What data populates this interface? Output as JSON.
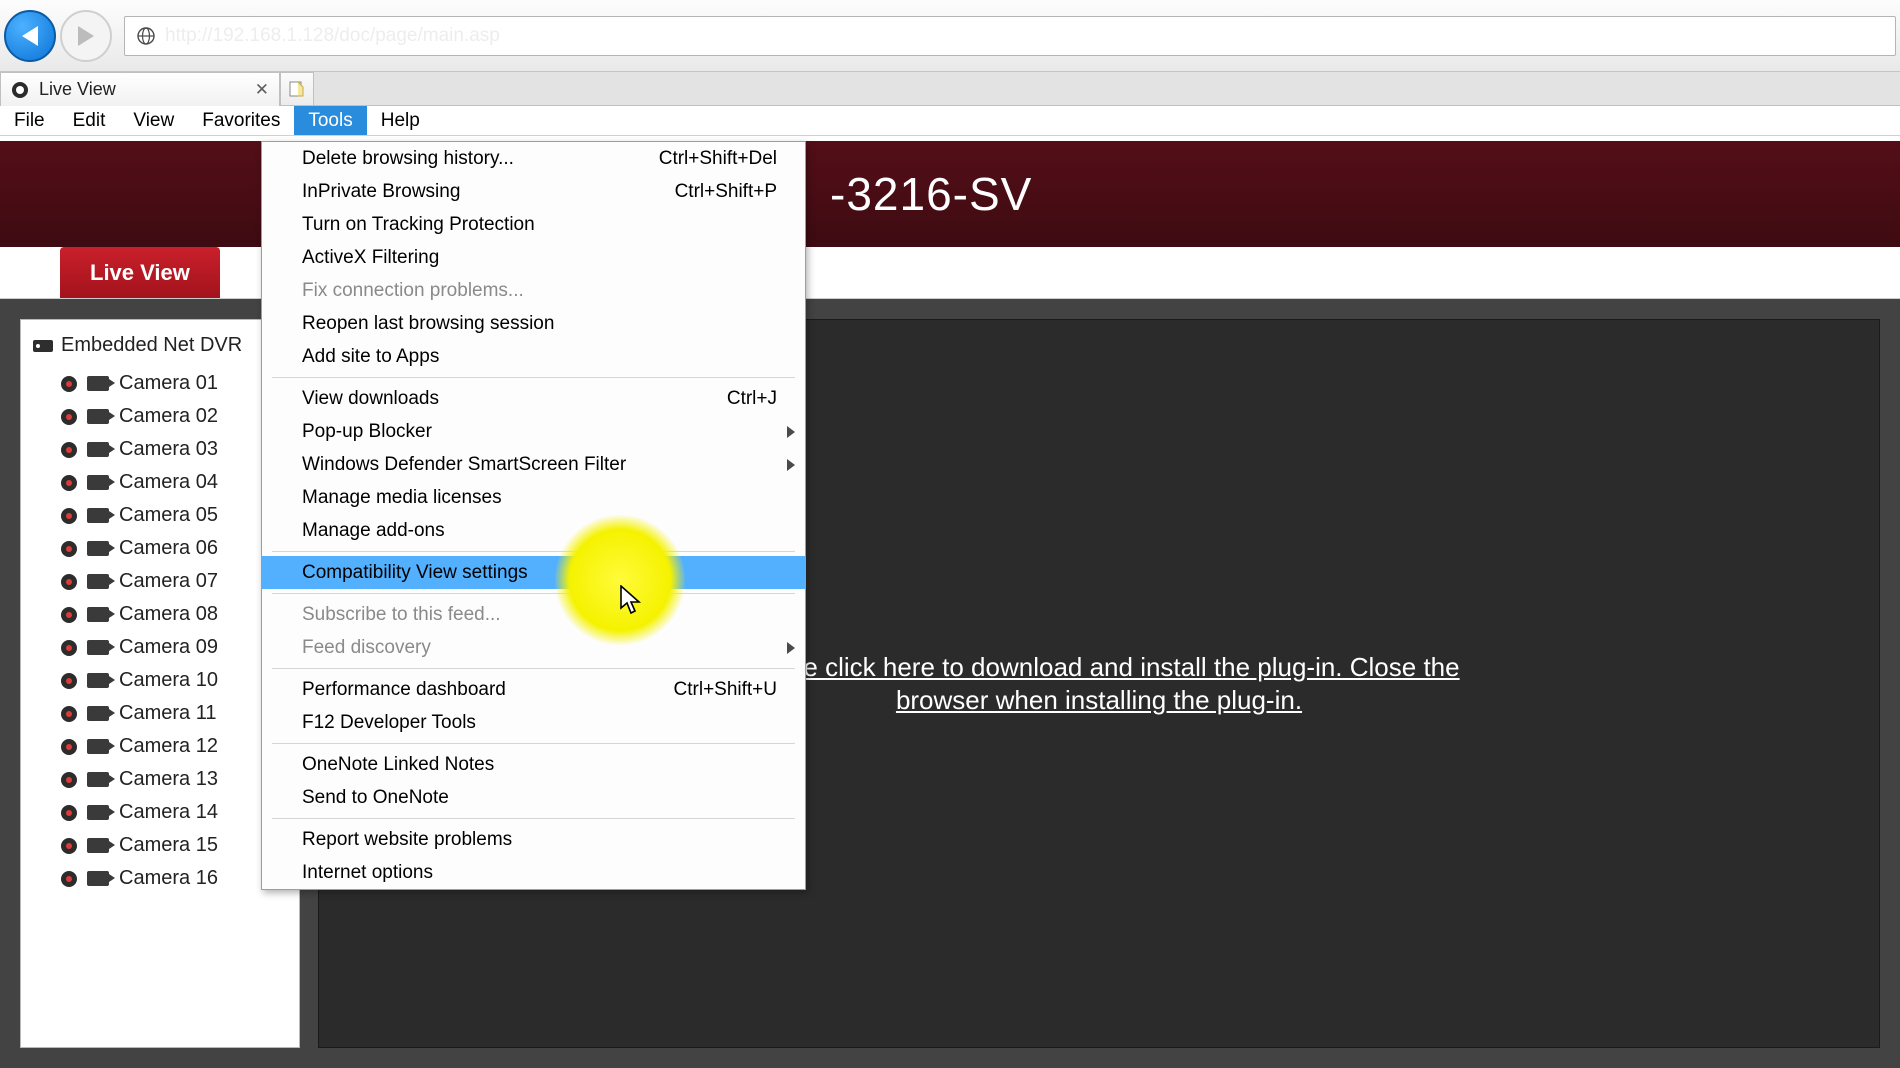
{
  "browser": {
    "address": "http://192.168.1.128/doc/page/main.asp",
    "tab_title": "Live View",
    "menubar": [
      "File",
      "Edit",
      "View",
      "Favorites",
      "Tools",
      "Help"
    ],
    "active_menu_index": 4
  },
  "tools_menu": [
    {
      "kind": "item",
      "label": "Delete browsing history...",
      "shortcut": "Ctrl+Shift+Del"
    },
    {
      "kind": "item",
      "label": "InPrivate Browsing",
      "shortcut": "Ctrl+Shift+P"
    },
    {
      "kind": "item",
      "label": "Turn on Tracking Protection"
    },
    {
      "kind": "item",
      "label": "ActiveX Filtering"
    },
    {
      "kind": "item",
      "label": "Fix connection problems...",
      "disabled": true
    },
    {
      "kind": "item",
      "label": "Reopen last browsing session"
    },
    {
      "kind": "item",
      "label": "Add site to Apps"
    },
    {
      "kind": "sep"
    },
    {
      "kind": "item",
      "label": "View downloads",
      "shortcut": "Ctrl+J"
    },
    {
      "kind": "item",
      "label": "Pop-up Blocker",
      "submenu": true
    },
    {
      "kind": "item",
      "label": "Windows Defender SmartScreen Filter",
      "submenu": true
    },
    {
      "kind": "item",
      "label": "Manage media licenses"
    },
    {
      "kind": "item",
      "label": "Manage add-ons"
    },
    {
      "kind": "sep"
    },
    {
      "kind": "item",
      "label": "Compatibility View settings",
      "highlight": true
    },
    {
      "kind": "sep"
    },
    {
      "kind": "item",
      "label": "Subscribe to this feed...",
      "disabled": true
    },
    {
      "kind": "item",
      "label": "Feed discovery",
      "disabled": true,
      "submenu": true
    },
    {
      "kind": "sep"
    },
    {
      "kind": "item",
      "label": "Performance dashboard",
      "shortcut": "Ctrl+Shift+U"
    },
    {
      "kind": "item",
      "label": "F12 Developer Tools"
    },
    {
      "kind": "sep"
    },
    {
      "kind": "item",
      "label": "OneNote Linked Notes"
    },
    {
      "kind": "item",
      "label": "Send to OneNote"
    },
    {
      "kind": "sep"
    },
    {
      "kind": "item",
      "label": "Report website problems"
    },
    {
      "kind": "item",
      "label": "Internet options"
    }
  ],
  "dvr": {
    "model_title_suffix": "-3216-SV",
    "tabs": {
      "live_view": "Live View"
    },
    "tree_root": "Embedded Net DVR",
    "cameras": [
      "Camera 01",
      "Camera 02",
      "Camera 03",
      "Camera 04",
      "Camera 05",
      "Camera 06",
      "Camera 07",
      "Camera 08",
      "Camera 09",
      "Camera 10",
      "Camera 11",
      "Camera 12",
      "Camera 13",
      "Camera 14",
      "Camera 15",
      "Camera 16"
    ],
    "plugin_message": "Please click here to download and install the plug-in. Close the browser when installing the plug-in."
  }
}
